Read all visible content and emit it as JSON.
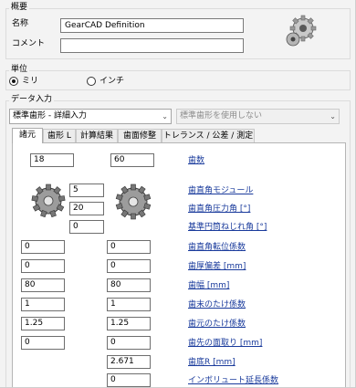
{
  "overview": {
    "title": "概要",
    "name_label": "名称",
    "name_value": "GearCAD Definition",
    "comment_label": "コメント",
    "comment_value": ""
  },
  "unit": {
    "title": "単位",
    "options": [
      "ミリ",
      "インチ"
    ],
    "selected": "ミリ"
  },
  "data_input": {
    "title": "データ入力",
    "combo_left": "標準歯形 - 詳細入力",
    "combo_right": "標準歯形を使用しない"
  },
  "tabs": [
    "諸元",
    "歯形 L",
    "計算結果",
    "歯面修整",
    "トレランス / 公差 / 測定"
  ],
  "active_tab": "諸元",
  "params": {
    "teeth": {
      "left": "18",
      "right": "60",
      "label": "歯数"
    },
    "module": {
      "value": "5",
      "label": "歯直角モジュール"
    },
    "pressure_angle": {
      "value": "20",
      "label": "歯直角圧力角 [°]"
    },
    "helix_angle": {
      "value": "0",
      "label": "基準円筒ねじれ角 [°]"
    },
    "shift_coeff": {
      "left": "0",
      "right": "0",
      "label": "歯直角転位係数"
    },
    "thickness_dev": {
      "left": "0",
      "right": "0",
      "label": "歯厚偏差 [mm]"
    },
    "face_width": {
      "left": "80",
      "right": "80",
      "label": "歯幅 [mm]"
    },
    "dedendum_coeff": {
      "left": "1",
      "right": "1",
      "label": "歯末のたけ係数"
    },
    "addendum_coeff": {
      "left": "1.25",
      "right": "1.25",
      "label": "歯元のたけ係数"
    },
    "tip_chamfer": {
      "left": "0",
      "right": "0",
      "label": "歯先の面取り [mm]"
    },
    "root_radius": {
      "right": "2.671",
      "label": "歯底R [mm]"
    },
    "involute_ext": {
      "right": "0",
      "label": "インボリュート延長係数"
    }
  },
  "colors": {
    "link": "#1a3b9c",
    "panel_bg": "#ffffff",
    "window_bg": "#f3f3f3"
  }
}
